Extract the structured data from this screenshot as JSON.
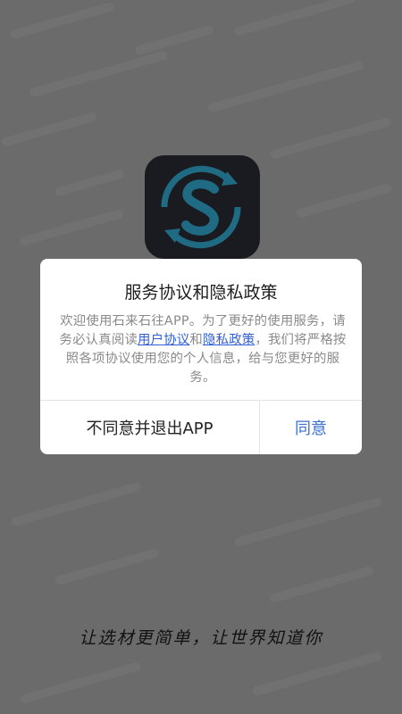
{
  "dialog": {
    "title": "服务协议和隐私政策",
    "body_part1": "欢迎使用石来石往APP。为了更好的使用服务，请务必认真阅读",
    "link_user_agreement": "用户协议",
    "body_and": "和",
    "link_privacy_policy": "隐私政策",
    "body_part2": "，我们将严格按照各项协议使用您的个人信息，给与您更好的服务。",
    "disagree_label": "不同意并退出APP",
    "agree_label": "同意"
  },
  "slogan": "让选材更简单，让世界知道你",
  "colors": {
    "overlay": "#6b6b6b",
    "icon_bg": "#1a1b20",
    "logo_ring": "#1f6b84",
    "link": "#2f5fd8",
    "agree": "#3b6fd4"
  },
  "icons": {
    "app_logo": "circular-s-arrows-logo"
  }
}
